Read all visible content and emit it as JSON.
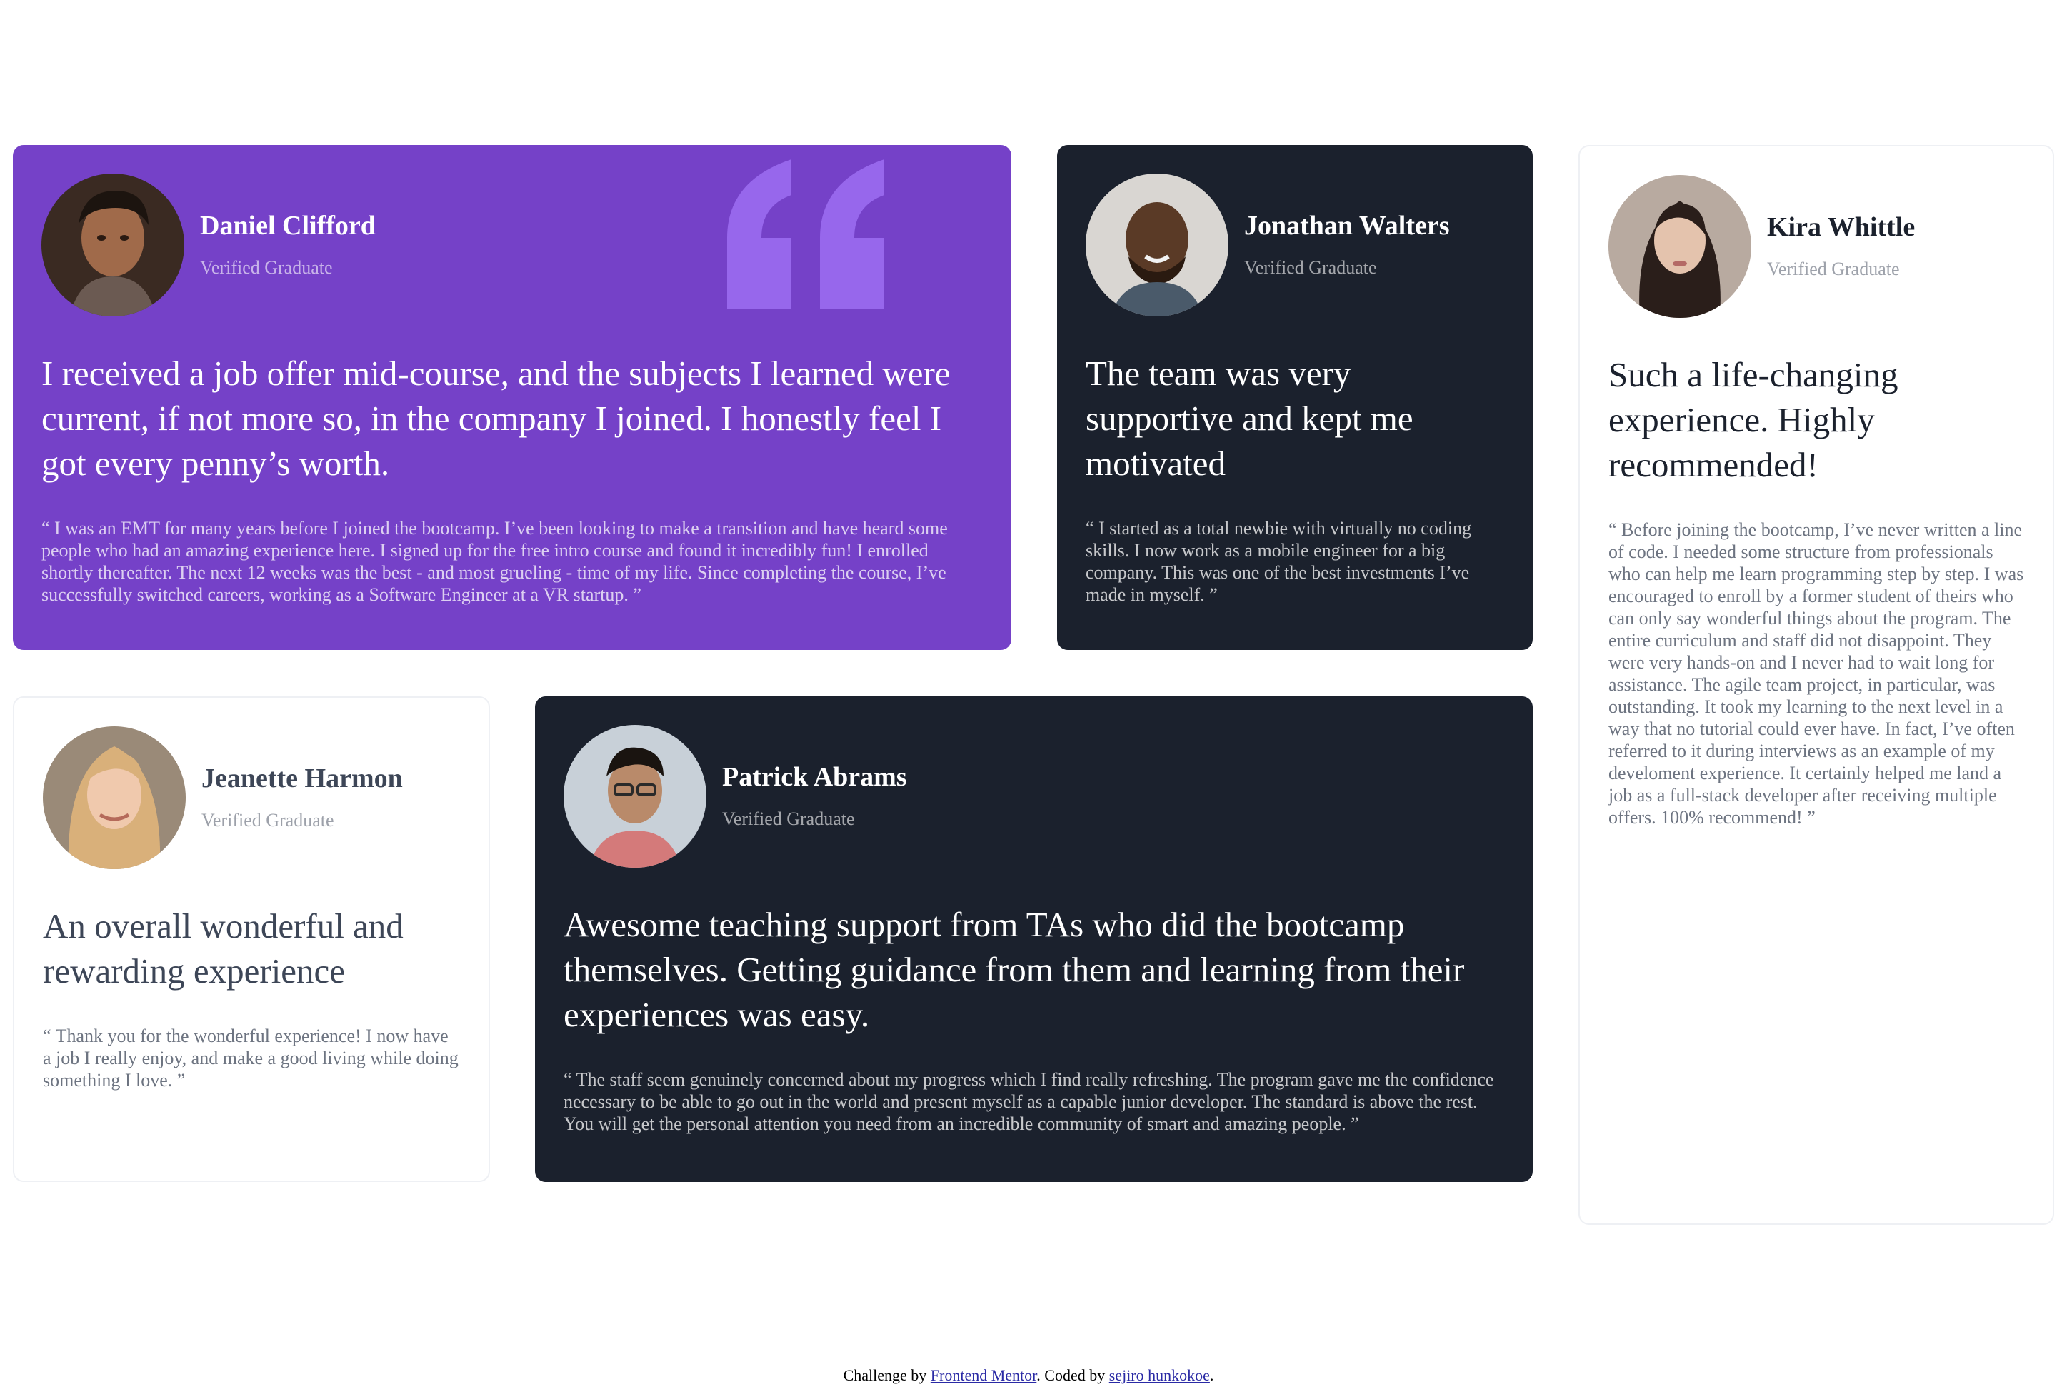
{
  "testimonials": [
    {
      "name": "Daniel Clifford",
      "role": "Verified Graduate",
      "headline": "I received a job offer mid-course, and the subjects I learned were current, if not more so, in the company I joined. I honestly feel I got every penny’s worth.",
      "body": "“ I was an EMT for many years before I joined the bootcamp. I’ve been looking to make a transition and have heard some people who had an amazing experience here. I signed up for the free intro course and found it incredibly fun! I enrolled shortly thereafter. The next 12 weeks was the best - and most grueling - time of my life. Since completing the course, I’ve successfully switched careers, working as a Software Engineer at a VR startup. ”",
      "bg_color": "#7541c8"
    },
    {
      "name": "Jonathan Walters",
      "role": "Verified Graduate",
      "headline": "The team was very supportive and kept me motivated",
      "body": "“ I started as a total newbie with virtually no coding skills. I now work as a mobile engineer for a big company. This was one of the best investments I’ve made in myself. ”",
      "bg_color": "#1b212d"
    },
    {
      "name": "Kira Whittle",
      "role": "Verified Graduate",
      "headline": "Such a life-changing experience. Highly recommended!",
      "body": "“ Before joining the bootcamp, I’ve never written a line of code. I needed some structure from professionals who can help me learn programming step by step. I was encouraged to enroll by a former student of theirs who can only say wonderful things about the program. The entire curriculum and staff did not disappoint. They were very hands-on and I never had to wait long for assistance. The agile team project, in particular, was outstanding. It took my learning to the next level in a way that no tutorial could ever have. In fact, I’ve often referred to it during interviews as an example of my develoment experience. It certainly helped me land a job as a full-stack developer after receiving multiple offers. 100% recommend! ”",
      "bg_color": "#ffffff"
    },
    {
      "name": "Jeanette Harmon",
      "role": "Verified Graduate",
      "headline": "An overall wonderful and rewarding experience",
      "body": "“ Thank you for the wonderful experience! I now have a job I really enjoy, and make a good living while doing something I love. ”",
      "bg_color": "#ffffff"
    },
    {
      "name": "Patrick Abrams",
      "role": "Verified Graduate",
      "headline": "Awesome teaching support from TAs who did the bootcamp themselves. Getting guidance from them and learning from their experiences was easy.",
      "body": "“ The staff seem genuinely concerned about my progress which I find really refreshing. The program gave me the confidence necessary to be able to go out in the world and present myself as a capable junior developer. The standard is above the rest. You will get the personal attention you need from an incredible community of smart and amazing people. ”",
      "bg_color": "#1b212d"
    }
  ],
  "footer": {
    "prefix": "Challenge by",
    "link1": "Frontend Mentor",
    "middle": ". Coded by",
    "link2": "sejiro hunkokoe",
    "suffix": "."
  },
  "icons": {
    "quote": "quotation-mark-icon"
  }
}
